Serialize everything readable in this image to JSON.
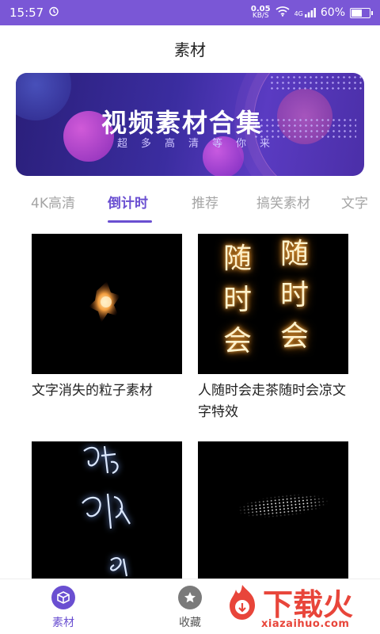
{
  "status": {
    "time": "15:57",
    "net_speed": "0.05",
    "net_unit": "KB/S",
    "signal": "4G",
    "battery": "60%"
  },
  "header": {
    "title": "素材"
  },
  "banner": {
    "title": "视频素材合集",
    "subtitle": "超多高清等你来"
  },
  "tabs": [
    {
      "label": "4K高清"
    },
    {
      "label": "倒计时",
      "active": true
    },
    {
      "label": "推荐"
    },
    {
      "label": "搞笑素材"
    },
    {
      "label": "文字"
    }
  ],
  "cards": [
    {
      "title": "文字消失的粒子素材",
      "thumb": "fire-particle"
    },
    {
      "title": "人随时会走茶随时会凉文字特效",
      "thumb": "sparkle-text"
    },
    {
      "title": "",
      "thumb": "glow-calligraphy"
    },
    {
      "title": "",
      "thumb": "particle-stream"
    }
  ],
  "thumb_text": {
    "left": "随时会",
    "right": "随时会"
  },
  "bottom_nav": [
    {
      "label": "素材",
      "icon": "cube-icon",
      "active": true
    },
    {
      "label": "收藏",
      "icon": "star-icon",
      "active": false
    }
  ],
  "watermark": {
    "name": "下载火",
    "url": "xiazaihuo.com"
  },
  "colors": {
    "primary": "#6a4fd1",
    "status_bar": "#7a57d6",
    "watermark": "#e8453a"
  }
}
